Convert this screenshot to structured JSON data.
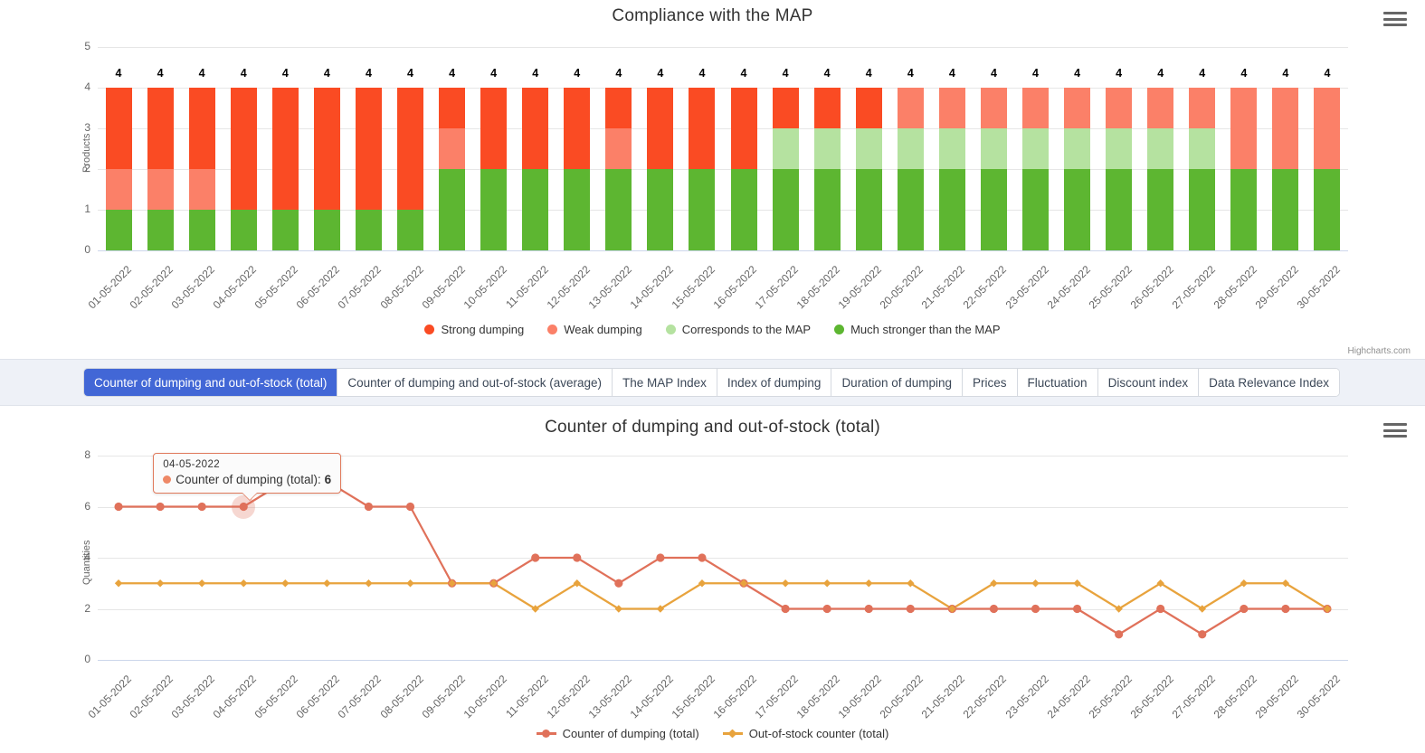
{
  "bar_chart": {
    "title": "Compliance with the MAP",
    "menu_icon": "hamburger-menu-icon",
    "credits": "Highcharts.com",
    "ylabel": "Products"
  },
  "line_chart": {
    "title": "Counter of dumping and out-of-stock (total)",
    "menu_icon": "hamburger-menu-icon",
    "ylabel": "Quantities"
  },
  "tabs": [
    {
      "label": "Counter of dumping and out-of-stock (total)",
      "active": true
    },
    {
      "label": "Counter of dumping and out-of-stock (average)",
      "active": false
    },
    {
      "label": "The MAP Index",
      "active": false
    },
    {
      "label": "Index of dumping",
      "active": false
    },
    {
      "label": "Duration of dumping",
      "active": false
    },
    {
      "label": "Prices",
      "active": false
    },
    {
      "label": "Fluctuation",
      "active": false
    },
    {
      "label": "Discount index",
      "active": false
    },
    {
      "label": "Data Relevance Index",
      "active": false
    }
  ],
  "tooltip": {
    "date": "04-05-2022",
    "series": "Counter of dumping (total)",
    "label": "Counter of dumping (total): ",
    "value": "6",
    "dot_color": "#ee8866"
  },
  "colors": {
    "strong_dumping": "#fa4b23",
    "weak_dumping": "#fb8068",
    "corresponds_map": "#b5e2a0",
    "much_stronger_map": "#5db631",
    "dumping_line": "#e0715a",
    "outofstock_line": "#e8a33d",
    "tab_active": "#4267d6",
    "grid": "#e6e6e6",
    "axis_text": "#666666"
  },
  "chart_data": [
    {
      "type": "bar",
      "title": "Compliance with the MAP",
      "xlabel": "",
      "ylabel": "Products",
      "ylim": [
        0,
        5
      ],
      "yticks": [
        0,
        1,
        2,
        3,
        4,
        5
      ],
      "grid": true,
      "stacked": true,
      "legend_position": "bottom",
      "data_labels": [
        4,
        4,
        4,
        4,
        4,
        4,
        4,
        4,
        4,
        4,
        4,
        4,
        4,
        4,
        4,
        4,
        4,
        4,
        4,
        4,
        4,
        4,
        4,
        4,
        4,
        4,
        4,
        4,
        4,
        4
      ],
      "categories": [
        "01-05-2022",
        "02-05-2022",
        "03-05-2022",
        "04-05-2022",
        "05-05-2022",
        "06-05-2022",
        "07-05-2022",
        "08-05-2022",
        "09-05-2022",
        "10-05-2022",
        "11-05-2022",
        "12-05-2022",
        "13-05-2022",
        "14-05-2022",
        "15-05-2022",
        "16-05-2022",
        "17-05-2022",
        "18-05-2022",
        "19-05-2022",
        "20-05-2022",
        "21-05-2022",
        "22-05-2022",
        "23-05-2022",
        "24-05-2022",
        "25-05-2022",
        "26-05-2022",
        "27-05-2022",
        "28-05-2022",
        "29-05-2022",
        "30-05-2022"
      ],
      "series": [
        {
          "name": "Much stronger than the MAP",
          "color": "#5db631",
          "values": [
            1,
            1,
            1,
            1,
            1,
            1,
            1,
            1,
            2,
            2,
            2,
            2,
            2,
            2,
            2,
            2,
            2,
            2,
            2,
            2,
            2,
            2,
            2,
            2,
            2,
            2,
            2,
            2,
            2,
            2
          ]
        },
        {
          "name": "Corresponds to the MAP",
          "color": "#b5e2a0",
          "values": [
            0,
            0,
            0,
            0,
            0,
            0,
            0,
            0,
            0,
            0,
            0,
            0,
            0,
            0,
            0,
            0,
            1,
            1,
            1,
            1,
            1,
            1,
            1,
            1,
            1,
            1,
            1,
            0,
            0,
            0
          ]
        },
        {
          "name": "Weak dumping",
          "color": "#fb8068",
          "values": [
            1,
            1,
            1,
            0,
            0,
            0,
            0,
            0,
            1,
            0,
            0,
            0,
            1,
            0,
            0,
            0,
            0,
            0,
            0,
            1,
            1,
            1,
            1,
            1,
            1,
            1,
            1,
            2,
            2,
            2
          ]
        },
        {
          "name": "Strong dumping",
          "color": "#fa4b23",
          "values": [
            2,
            2,
            2,
            3,
            3,
            3,
            3,
            3,
            1,
            2,
            2,
            2,
            1,
            2,
            2,
            2,
            1,
            1,
            1,
            0,
            0,
            0,
            0,
            0,
            0,
            0,
            0,
            0,
            0,
            0
          ]
        }
      ]
    },
    {
      "type": "line",
      "title": "Counter of dumping and out-of-stock (total)",
      "xlabel": "",
      "ylabel": "Quantities",
      "ylim": [
        0,
        8
      ],
      "yticks": [
        0,
        2,
        4,
        6,
        8
      ],
      "grid": true,
      "legend_position": "bottom",
      "categories": [
        "01-05-2022",
        "02-05-2022",
        "03-05-2022",
        "04-05-2022",
        "05-05-2022",
        "06-05-2022",
        "07-05-2022",
        "08-05-2022",
        "09-05-2022",
        "10-05-2022",
        "11-05-2022",
        "12-05-2022",
        "13-05-2022",
        "14-05-2022",
        "15-05-2022",
        "16-05-2022",
        "17-05-2022",
        "18-05-2022",
        "19-05-2022",
        "20-05-2022",
        "21-05-2022",
        "22-05-2022",
        "23-05-2022",
        "24-05-2022",
        "25-05-2022",
        "26-05-2022",
        "27-05-2022",
        "28-05-2022",
        "29-05-2022",
        "30-05-2022"
      ],
      "series": [
        {
          "name": "Counter of dumping (total)",
          "color": "#e0715a",
          "marker": "circle",
          "values": [
            6,
            6,
            6,
            6,
            7,
            7,
            6,
            6,
            3,
            3,
            4,
            4,
            3,
            4,
            4,
            3,
            2,
            2,
            2,
            2,
            2,
            2,
            2,
            2,
            1,
            2,
            1,
            2,
            2,
            2
          ]
        },
        {
          "name": "Out-of-stock counter (total)",
          "color": "#e8a33d",
          "marker": "diamond",
          "values": [
            3,
            3,
            3,
            3,
            3,
            3,
            3,
            3,
            3,
            3,
            2,
            3,
            2,
            2,
            3,
            3,
            3,
            3,
            3,
            3,
            2,
            3,
            3,
            3,
            2,
            3,
            2,
            3,
            3,
            2
          ]
        }
      ]
    }
  ]
}
